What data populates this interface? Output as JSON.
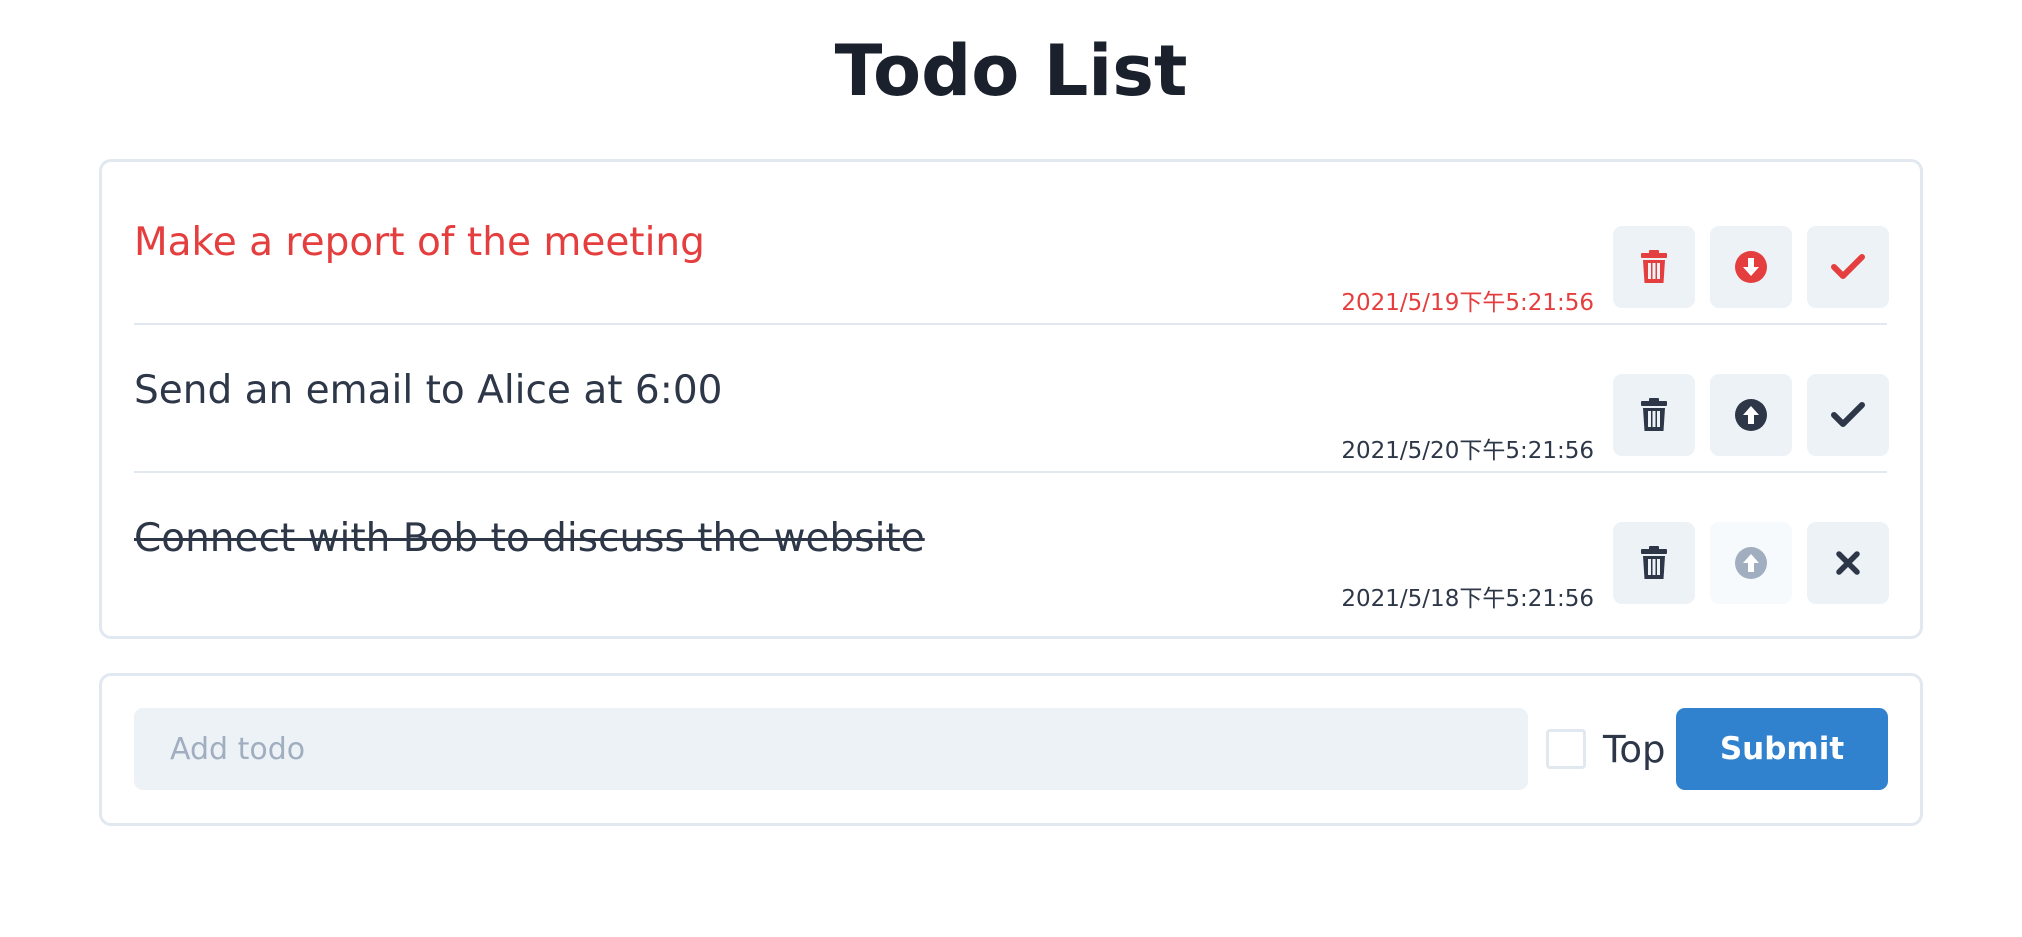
{
  "page": {
    "title": "Todo List"
  },
  "colors": {
    "priority": "#e53e3e",
    "normal": "#2d3748",
    "accent": "#3182ce",
    "button_bg": "#edf2f7",
    "border": "#e2e8f0"
  },
  "todos": [
    {
      "text": "Make a report of the meeting",
      "time": "2021/5/19下午5:21:56",
      "priority": true,
      "done": false,
      "icons": [
        "trash-icon",
        "arrow-circle-down-icon",
        "check-icon"
      ]
    },
    {
      "text": "Send an email to Alice at 6:00",
      "time": "2021/5/20下午5:21:56",
      "priority": false,
      "done": false,
      "icons": [
        "trash-icon",
        "arrow-circle-up-icon",
        "check-icon"
      ]
    },
    {
      "text": "Connect with Bob to discuss the website",
      "time": "2021/5/18下午5:21:56",
      "priority": false,
      "done": true,
      "icons": [
        "trash-icon",
        "arrow-circle-up-icon",
        "x-icon"
      ]
    }
  ],
  "form": {
    "input_placeholder": "Add todo",
    "input_value": "",
    "top_label": "Top",
    "top_checked": false,
    "submit_label": "Submit"
  }
}
